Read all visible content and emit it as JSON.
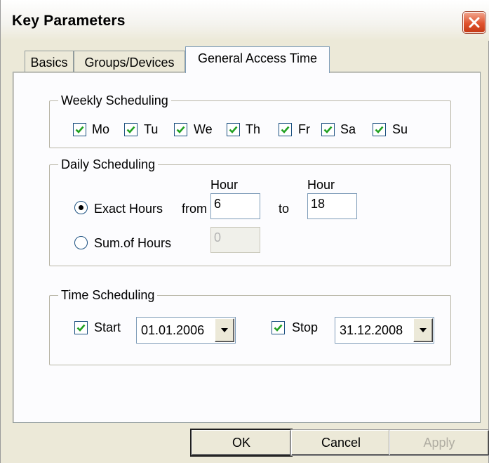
{
  "window": {
    "title": "Key Parameters"
  },
  "tabs": [
    {
      "label": "Basics",
      "active": false
    },
    {
      "label": "Groups/Devices",
      "active": false
    },
    {
      "label": "General Access Time",
      "active": true
    }
  ],
  "weekly": {
    "title": "Weekly Scheduling",
    "days": [
      {
        "label": "Mo",
        "checked": true
      },
      {
        "label": "Tu",
        "checked": true
      },
      {
        "label": "We",
        "checked": true
      },
      {
        "label": "Th",
        "checked": true
      },
      {
        "label": "Fr",
        "checked": true
      },
      {
        "label": "Sa",
        "checked": true
      },
      {
        "label": "Su",
        "checked": true
      }
    ]
  },
  "daily": {
    "title": "Daily Scheduling",
    "hour_label_from": "Hour",
    "hour_label_to": "Hour",
    "exact_hours_label": "Exact Hours",
    "from_label": "from",
    "from_value": "6",
    "to_label": "to",
    "to_value": "18",
    "sum_label": "Sum.of Hours",
    "sum_value": "0",
    "selected_mode": "Exact Hours"
  },
  "time": {
    "title": "Time Scheduling",
    "start_label": "Start",
    "start_checked": true,
    "start_date": "01.01.2006",
    "stop_label": "Stop",
    "stop_checked": true,
    "stop_date": "31.12.2008"
  },
  "buttons": {
    "ok": "OK",
    "cancel": "Cancel",
    "apply": "Apply"
  },
  "colors": {
    "check": "#21a121",
    "close_button": "#e0532e"
  }
}
